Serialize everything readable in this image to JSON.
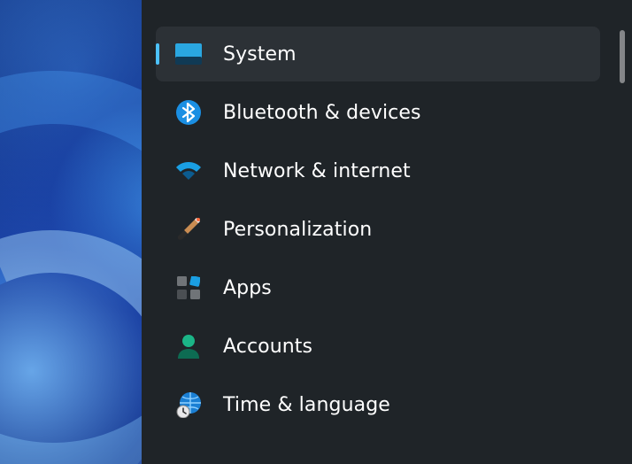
{
  "nav": {
    "selected_index": 0,
    "items": [
      {
        "label": "System"
      },
      {
        "label": "Bluetooth & devices"
      },
      {
        "label": "Network & internet"
      },
      {
        "label": "Personalization"
      },
      {
        "label": "Apps"
      },
      {
        "label": "Accounts"
      },
      {
        "label": "Time & language"
      }
    ]
  }
}
